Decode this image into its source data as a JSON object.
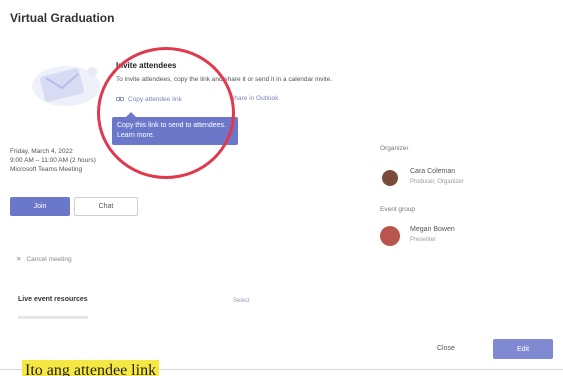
{
  "dialog": {
    "title": "Virtual Graduation"
  },
  "invite": {
    "heading": "Invite attendees",
    "instructions": "To invite attendees, copy the link and share it or send it in a calendar invite.",
    "copy_link_label": "Copy attendee link",
    "outlook_label": "Share in Outlook",
    "tooltip_text": "Copy this link to send to attendees. Learn more."
  },
  "event": {
    "date": "Friday, March 4, 2022",
    "time": "9:00 AM – 11:00 AM (2 hours)",
    "location": "Microsoft Teams Meeting"
  },
  "actions": {
    "join_label": "Join",
    "chat_label": "Chat",
    "cancel_label": "Cancel meeting"
  },
  "organizer": {
    "label": "Organizer",
    "name": "Cara Coleman",
    "role": "Producer, Organizer"
  },
  "event_group": {
    "label": "Event group",
    "name": "Megan Bowen",
    "role": "Presenter"
  },
  "resources": {
    "heading": "Live event resources",
    "link": "Select"
  },
  "footer": {
    "close_label": "Close",
    "edit_label": "Edit"
  },
  "caption": {
    "text": "Ito ang attendee link"
  },
  "colors": {
    "accent": "#6b78c9",
    "highlight_circle": "#e0394d",
    "caption_highlight": "#f6e843"
  }
}
